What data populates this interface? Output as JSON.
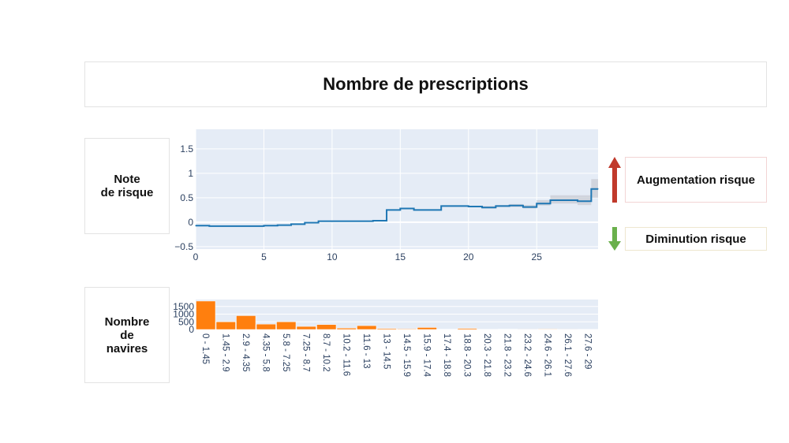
{
  "title": "Nombre de prescriptions",
  "labels": {
    "risk_score": "Note\nde risque",
    "ship_count": "Nombre\nde\nnavires",
    "risk_up": "Augmentation risque",
    "risk_down": "Diminution risque"
  },
  "colors": {
    "plot_bg": "#e5ecf6",
    "line": "#1f77b4",
    "band": "#c8ccd4",
    "bar": "#ff7f0e",
    "arrow_up": "#c0392b",
    "arrow_down": "#6ab04c",
    "tick_text": "#2a3f5f"
  },
  "icons": {
    "up": "arrow-up-icon",
    "down": "arrow-down-icon"
  },
  "chart_data": [
    {
      "type": "line",
      "step": true,
      "xlim": [
        0,
        29.5
      ],
      "ylim": [
        -0.55,
        1.9
      ],
      "x_ticks": [
        0,
        5,
        10,
        15,
        20,
        25
      ],
      "y_ticks": [
        -0.5,
        0,
        0.5,
        1,
        1.5
      ],
      "y_tick_labels": [
        "−0.5",
        "0",
        "0.5",
        "1",
        "1.5"
      ],
      "grid": true,
      "legend": "none",
      "x": [
        0,
        1,
        2,
        3,
        4,
        5,
        6,
        7,
        8,
        9,
        10,
        11,
        12,
        13,
        14,
        15,
        16,
        17,
        18,
        19,
        20,
        21,
        22,
        23,
        24,
        25,
        26,
        27,
        28,
        29,
        29.5
      ],
      "y": [
        -0.07,
        -0.08,
        -0.08,
        -0.08,
        -0.08,
        -0.07,
        -0.06,
        -0.04,
        -0.01,
        0.02,
        0.02,
        0.02,
        0.02,
        0.03,
        0.25,
        0.28,
        0.25,
        0.25,
        0.33,
        0.33,
        0.32,
        0.3,
        0.33,
        0.34,
        0.31,
        0.38,
        0.45,
        0.45,
        0.43,
        0.68,
        0.68
      ],
      "upper": [
        -0.07,
        -0.08,
        -0.08,
        -0.08,
        -0.08,
        -0.07,
        -0.06,
        -0.04,
        -0.01,
        0.02,
        0.02,
        0.02,
        0.02,
        0.03,
        0.25,
        0.29,
        0.26,
        0.26,
        0.34,
        0.34,
        0.33,
        0.33,
        0.35,
        0.37,
        0.35,
        0.45,
        0.55,
        0.55,
        0.55,
        0.88,
        0.88
      ],
      "lower": [
        -0.07,
        -0.08,
        -0.08,
        -0.08,
        -0.08,
        -0.07,
        -0.06,
        -0.04,
        -0.01,
        0.02,
        0.02,
        0.02,
        0.02,
        0.03,
        0.25,
        0.27,
        0.24,
        0.24,
        0.32,
        0.32,
        0.31,
        0.28,
        0.31,
        0.31,
        0.28,
        0.34,
        0.38,
        0.38,
        0.35,
        0.5,
        0.5
      ]
    },
    {
      "type": "bar",
      "ylim": [
        0,
        1950
      ],
      "y_ticks": [
        0,
        500,
        1000,
        1500
      ],
      "y_tick_labels": [
        "0",
        "500",
        "1000",
        "1500"
      ],
      "grid": true,
      "legend": "none",
      "categories": [
        "0 - 1.45",
        "1.45 - 2.9",
        "2.9 - 4.35",
        "4.35 - 5.8",
        "5.8 - 7.25",
        "7.25 - 8.7",
        "8.7 - 10.2",
        "10.2 - 11.6",
        "11.6 - 13",
        "13 - 14.5",
        "14.5 - 15.9",
        "15.9 - 17.4",
        "17.4 - 18.8",
        "18.8 - 20.3",
        "20.3 - 21.8",
        "21.8 - 23.2",
        "23.2 - 24.6",
        "24.6 - 26.1",
        "26.1 - 27.6",
        "27.6 - 29"
      ],
      "values": [
        1850,
        500,
        900,
        350,
        500,
        200,
        320,
        90,
        250,
        60,
        40,
        130,
        20,
        70,
        15,
        25,
        10,
        30,
        10,
        15
      ]
    }
  ]
}
